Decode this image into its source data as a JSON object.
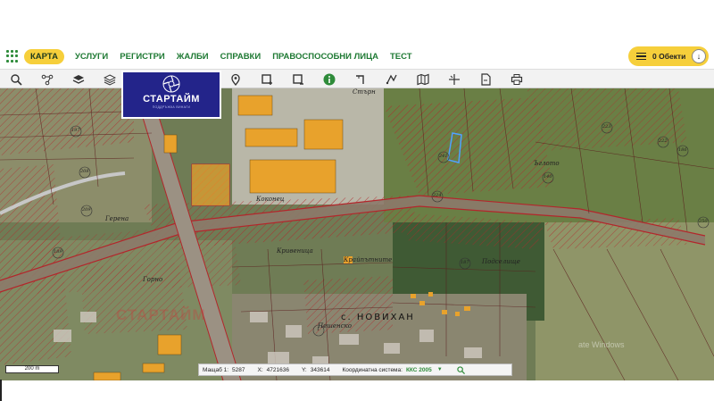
{
  "menu": {
    "items": [
      {
        "label": "КАРТА",
        "active": true
      },
      {
        "label": "УСЛУГИ",
        "active": false
      },
      {
        "label": "РЕГИСТРИ",
        "active": false
      },
      {
        "label": "ЖАЛБИ",
        "active": false
      },
      {
        "label": "СПРАВКИ",
        "active": false
      },
      {
        "label": "ПРАВОСПОСОБНИ ЛИЦА",
        "active": false
      },
      {
        "label": "ТЕСТ",
        "active": false
      }
    ],
    "objects_label": "0 Обекти"
  },
  "toolbar": {
    "icons": [
      "search-icon",
      "network-icon",
      "layers-icon",
      "layers-stack-icon",
      "location-pin-icon",
      "draw-rectangle-icon",
      "draw-rectangle-remove-icon",
      "info-icon",
      "measure-angle-icon",
      "ruler-icon",
      "map-icon",
      "crosshair-icon",
      "document-icon",
      "printer-icon"
    ]
  },
  "logo": {
    "name": "СТАРТАЙМ",
    "tagline": "ПОДДРЪЖКА ВИНАГИ"
  },
  "map": {
    "town_label": "с. НОВИХАН",
    "watermark": "СТАРТАЙМ",
    "windows_watermark": "ate Windows",
    "labels": [
      "Коконец",
      "Пешенско",
      "Подселище",
      "Ъглото",
      "Стърн",
      "Крайпътните",
      "Герена",
      "Горно",
      "Кривеница"
    ],
    "parcel_numbers": [
      "197",
      "208",
      "209",
      "189",
      "241",
      "224",
      "223",
      "222",
      "186",
      "187",
      "140",
      "1",
      "250"
    ],
    "scale_label": "200 m"
  },
  "status": {
    "scale_label": "Мащаб 1:",
    "scale_value": "5287",
    "x_label": "X:",
    "x_value": "4721636",
    "y_label": "Y:",
    "y_value": "343614",
    "crs_label": "Координатна система:",
    "crs_value": "ККС 2005"
  },
  "colors": {
    "menu_green": "#1f7a34",
    "active_yellow": "#f6cf3b",
    "logo_blue": "#23248a",
    "parcel_red": "#b3262b",
    "building_orange": "#e8a22c",
    "selection_blue": "#4fa3ff"
  }
}
